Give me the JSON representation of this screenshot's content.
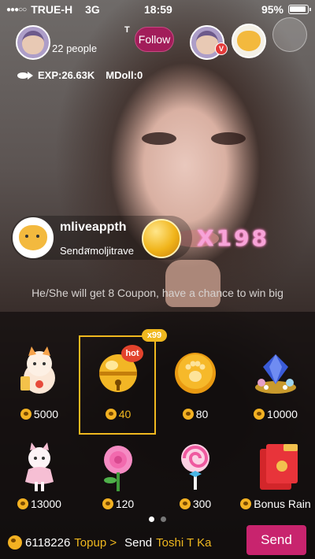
{
  "status_bar": {
    "carrier": "TRUE-H",
    "network": "3G",
    "time": "18:59",
    "battery": "95%"
  },
  "host": {
    "viewers": "22 people",
    "follow_label": "Follow",
    "t_mark": "T",
    "vip_badge": "V",
    "exp": "EXP:26.63K",
    "mdoll": "MDoll:0"
  },
  "gift_notice": {
    "sender": "mliveappth",
    "action": "Sendสmoljitrave",
    "combo": "X198"
  },
  "promo_text": "He/She will get 8 Coupon, have a chance to win big",
  "gift_panel": {
    "hot_label": "hot",
    "count_badge": "x99",
    "gifts": [
      {
        "name": "lucky-cat",
        "price": "5000"
      },
      {
        "name": "bell",
        "price": "40"
      },
      {
        "name": "gold-coin",
        "price": "80"
      },
      {
        "name": "gem-pile",
        "price": "10000"
      },
      {
        "name": "cat-girl",
        "price": "13000"
      },
      {
        "name": "rose",
        "price": "120"
      },
      {
        "name": "lollipop",
        "price": "300"
      },
      {
        "name": "red-envelope",
        "price": "Bonus Rain"
      }
    ]
  },
  "bottom_bar": {
    "balance": "6118226",
    "topup_label": "Topup >",
    "send_label": "Send",
    "recipient": "Toshi T Ka",
    "send_button": "Send"
  },
  "colors": {
    "accent_gold": "#f0b81f",
    "follow_bg": "#a21d5a",
    "send_bg": "#c8246e"
  }
}
